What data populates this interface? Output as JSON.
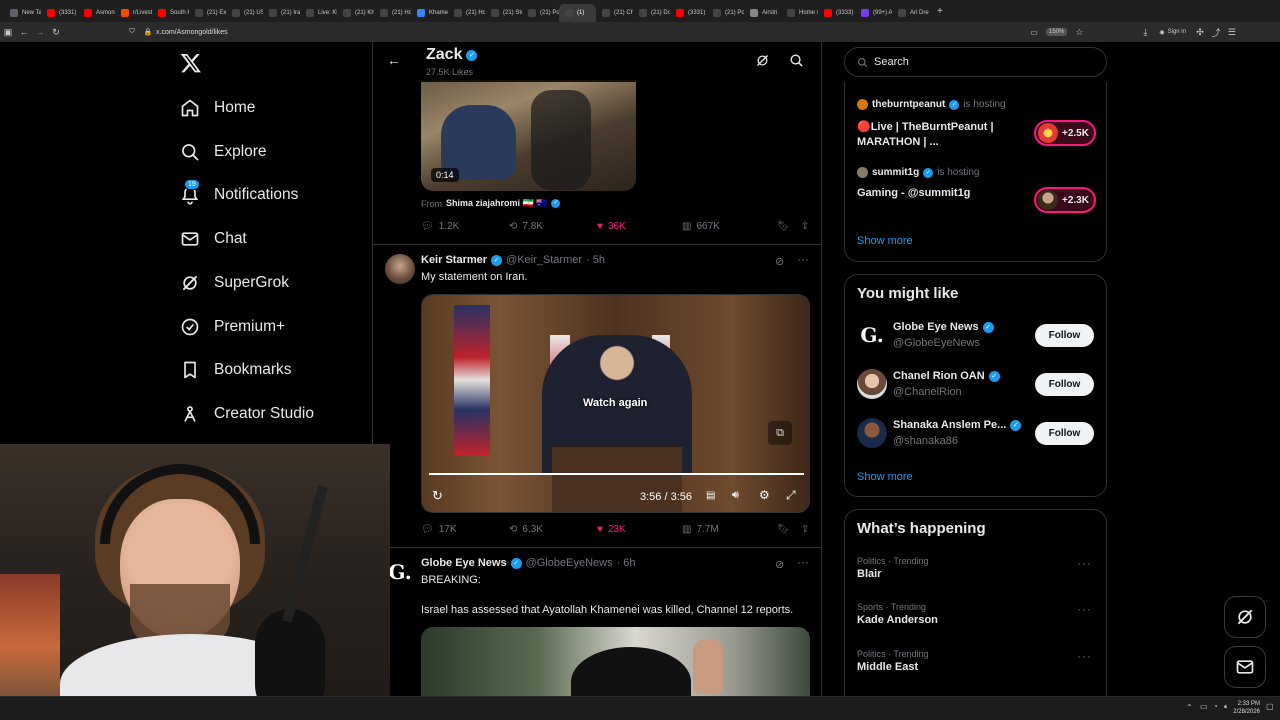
{
  "browser": {
    "tabs": [
      {
        "label": "New Tab",
        "color": "#5f6368"
      },
      {
        "label": "(3331) Y",
        "color": "#ff0000"
      },
      {
        "label": "Asmong",
        "color": "#ff0000"
      },
      {
        "label": "r/Livestr",
        "color": "#ff4500"
      },
      {
        "label": "South K",
        "color": "#ff0000"
      },
      {
        "label": "(21) Exp",
        "color": "#444"
      },
      {
        "label": "(21) US",
        "color": "#444"
      },
      {
        "label": "(21) Iran",
        "color": "#444"
      },
      {
        "label": "Live: Kh",
        "color": "#444"
      },
      {
        "label": "(21) Kh",
        "color": "#444"
      },
      {
        "label": "(21) Hon",
        "color": "#444"
      },
      {
        "label": "Khamen",
        "color": "#3b82f6"
      },
      {
        "label": "(21) Hon",
        "color": "#444"
      },
      {
        "label": "(21) Ste",
        "color": "#444"
      },
      {
        "label": "(21) Pos",
        "color": "#444"
      },
      {
        "label": "(1)",
        "color": "#444",
        "active": true
      },
      {
        "label": "(21) Chu",
        "color": "#444"
      },
      {
        "label": "(21) Dor",
        "color": "#444"
      },
      {
        "label": "(3331) Li",
        "color": "#ff0000"
      },
      {
        "label": "(21) Pos",
        "color": "#444"
      },
      {
        "label": "Airstri",
        "color": "#888"
      },
      {
        "label": "Home /",
        "color": "#444"
      },
      {
        "label": "(3333) Y",
        "color": "#ff0000"
      },
      {
        "label": "(99+) Al",
        "color": "#7c3aed"
      },
      {
        "label": "Ari Dre",
        "color": "#444"
      }
    ],
    "url": "x.com/Asmongold/likes",
    "zoom": "150%",
    "signin": "Sign in"
  },
  "nav": {
    "logo": "X",
    "items": [
      {
        "label": "Home",
        "icon": "home-icon"
      },
      {
        "label": "Explore",
        "icon": "search-icon"
      },
      {
        "label": "Notifications",
        "icon": "bell-icon",
        "badge": "19"
      },
      {
        "label": "Chat",
        "icon": "mail-icon"
      },
      {
        "label": "SuperGrok",
        "icon": "grok-icon"
      },
      {
        "label": "Premium+",
        "icon": "premium-icon"
      },
      {
        "label": "Bookmarks",
        "icon": "bookmark-icon"
      },
      {
        "label": "Creator Studio",
        "icon": "creator-icon"
      }
    ]
  },
  "header": {
    "title": "Zack",
    "subtitle": "27.5K Likes"
  },
  "posts": [
    {
      "video_time": "0:14",
      "from_label": "From",
      "from_name": "Shima ziajahromi 🇮🇷 🇦🇺",
      "replies": "1.2K",
      "reposts": "7.8K",
      "likes": "36K",
      "views": "667K"
    },
    {
      "name": "Keir Starmer",
      "handle": "@Keir_Starmer",
      "time": "· 5h",
      "text": "My statement on Iran.",
      "watch_again": "Watch again",
      "video_time": "3:56 / 3:56",
      "replies": "17K",
      "reposts": "6.3K",
      "likes": "23K",
      "views": "7.7M"
    },
    {
      "name": "Globe Eye News",
      "handle": "@GlobeEyeNews",
      "time": "· 6h",
      "text1": "BREAKING:",
      "text2": "Israel has assessed that Ayatollah Khamenei was killed, Channel 12 reports."
    }
  ],
  "right": {
    "search_placeholder": "Search",
    "live": [
      {
        "host": "theburntpeanut",
        "hosting": "is hosting",
        "title1": "🔴Live | TheBurntPeanut |",
        "title2": "MARATHON | ...",
        "count": "+2.5K"
      },
      {
        "host": "summit1g",
        "hosting": "is hosting",
        "title1": "Gaming - @summit1g",
        "title2": "",
        "count": "+2.3K"
      }
    ],
    "show_more_1": "Show more",
    "you_might_like": {
      "title": "You might like",
      "accounts": [
        {
          "name": "Globe Eye News",
          "handle": "@GlobeEyeNews",
          "button": "Follow"
        },
        {
          "name": "Chanel Rion OAN",
          "handle": "@ChanelRion",
          "button": "Follow"
        },
        {
          "name": "Shanaka Anslem Pe...",
          "handle": "@shanaka86",
          "button": "Follow"
        }
      ],
      "show_more": "Show more"
    },
    "happening": {
      "title": "What’s happening",
      "trends": [
        {
          "category": "Politics · Trending",
          "topic": "Blair"
        },
        {
          "category": "Sports · Trending",
          "topic": "Kade Anderson"
        },
        {
          "category": "Politics · Trending",
          "topic": "Middle East"
        }
      ]
    }
  },
  "taskbar": {
    "time": "2:33 PM",
    "date": "2/28/2026"
  },
  "colors": {
    "accent": "#1d9bf0",
    "like": "#f91880",
    "bg": "#000000",
    "border": "#2f3336"
  }
}
